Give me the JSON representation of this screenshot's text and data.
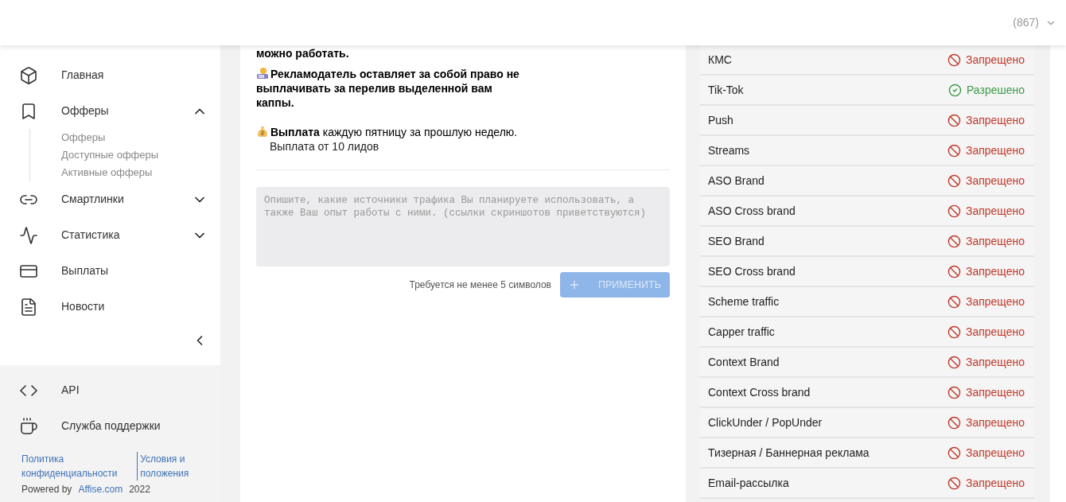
{
  "header": {
    "count": "(867)"
  },
  "sidebar": {
    "items": [
      {
        "label": "Главная"
      },
      {
        "label": "Офферы",
        "expanded": true,
        "children": [
          {
            "label": "Офферы"
          },
          {
            "label": "Доступные офферы"
          },
          {
            "label": "Активные офферы"
          }
        ]
      },
      {
        "label": "Смартлинки",
        "expanded": false
      },
      {
        "label": "Статистика",
        "expanded": false
      },
      {
        "label": "Выплаты"
      },
      {
        "label": "Новости"
      }
    ],
    "footer_items": [
      {
        "label": "API"
      },
      {
        "label": "Служба поддержки"
      }
    ],
    "links": [
      "Политика конфиденциальности",
      "Условия и положения"
    ],
    "powered": {
      "prefix": "Powered by",
      "link": "Affise.com",
      "year": "2022"
    }
  },
  "content": {
    "paragraphs": [
      {
        "text": "**можно работать.**"
      },
      {
        "text": "**Рекламодатель оставляет за собой право не выплачивать за перелив выделенной вам каппы.**"
      },
      {
        "text": "**Выплата** каждую пятницу за прошлую неделю.",
        "line2": "Выплата от 10 лидов"
      }
    ],
    "field": {
      "placeholder": "Опишите, какие источники трафика Вы планируете использовать, а также Ваш опыт работы с ними. (ссылки скриншотов приветствуются)"
    },
    "hint": "Требуется не менее 5 символов",
    "button": {
      "label": "ПРИМЕНИТЬ",
      "disabled": true
    }
  },
  "traffic": [
    {
      "name": "КМС",
      "status": "Запрещено",
      "kind": "forbidden"
    },
    {
      "name": "Tik-Tok",
      "status": "Разрешено",
      "kind": "allowed"
    },
    {
      "name": "Push",
      "status": "Запрещено",
      "kind": "forbidden"
    },
    {
      "name": "Streams",
      "status": "Запрещено",
      "kind": "forbidden"
    },
    {
      "name": "ASO Brand",
      "status": "Запрещено",
      "kind": "forbidden"
    },
    {
      "name": "ASO Cross brand",
      "status": "Запрещено",
      "kind": "forbidden"
    },
    {
      "name": "SEO Brand",
      "status": "Запрещено",
      "kind": "forbidden"
    },
    {
      "name": "SEO Cross brand",
      "status": "Запрещено",
      "kind": "forbidden"
    },
    {
      "name": "Scheme traffic",
      "status": "Запрещено",
      "kind": "forbidden"
    },
    {
      "name": "Capper traffic",
      "status": "Запрещено",
      "kind": "forbidden"
    },
    {
      "name": "Context Brand",
      "status": "Запрещено",
      "kind": "forbidden"
    },
    {
      "name": "Context Cross brand",
      "status": "Запрещено",
      "kind": "forbidden"
    },
    {
      "name": "ClickUnder / PopUnder",
      "status": "Запрещено",
      "kind": "forbidden"
    },
    {
      "name": "Тизерная / Баннерная реклама",
      "status": "Запрещено",
      "kind": "forbidden"
    },
    {
      "name": "Email-рассылка",
      "status": "Запрещено",
      "kind": "forbidden"
    }
  ]
}
